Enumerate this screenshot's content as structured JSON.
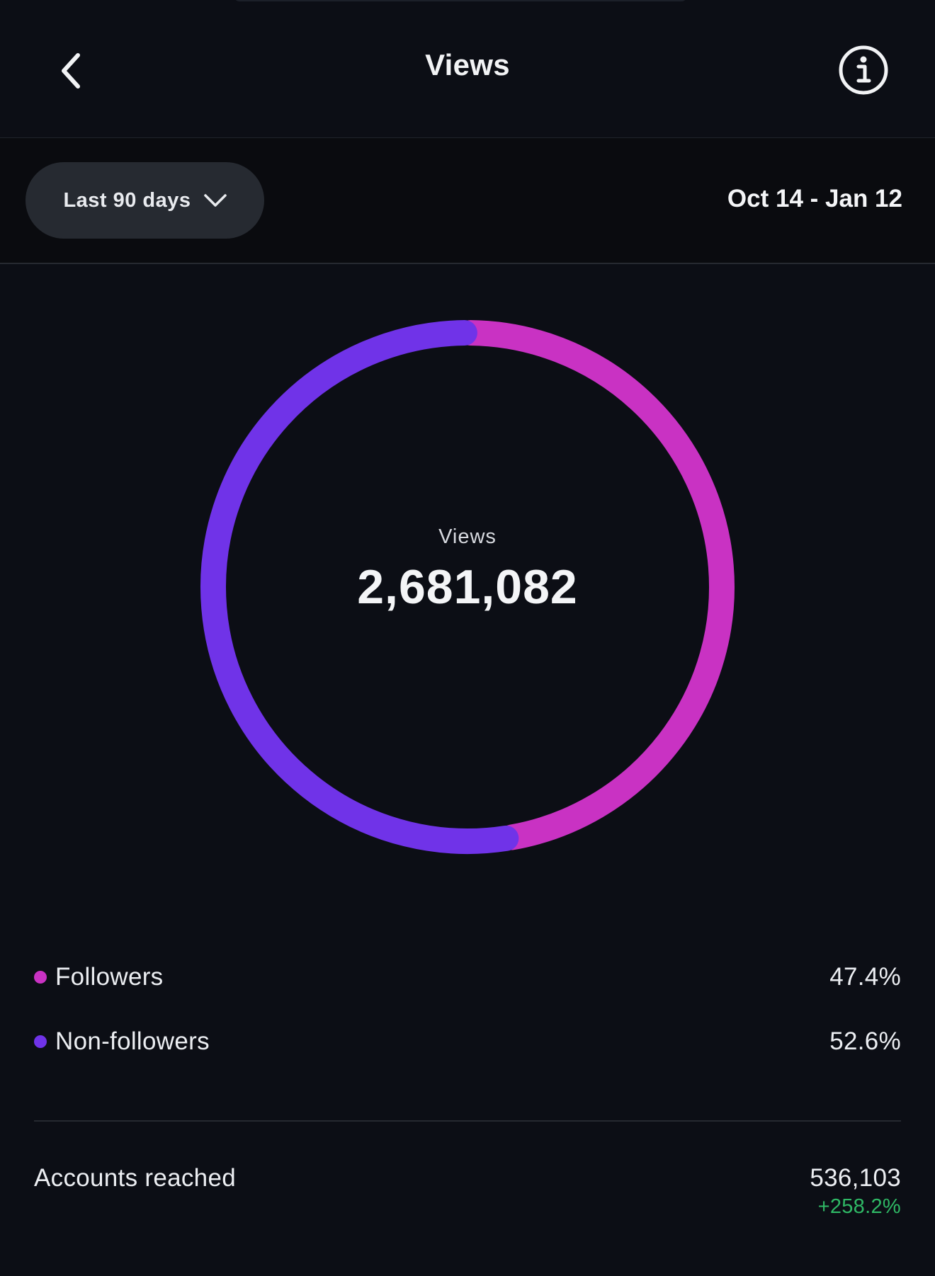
{
  "header": {
    "title": "Views",
    "back_icon": "chevron-left-icon",
    "info_icon": "info-icon"
  },
  "filter": {
    "range_label": "Last 90 days",
    "range_icon": "chevron-down-icon",
    "date_range": "Oct 14 - Jan 12"
  },
  "summary": {
    "label": "Views",
    "total": "2,681,082"
  },
  "chart_data": {
    "type": "pie",
    "variant": "donut",
    "slices": [
      {
        "name": "Followers",
        "value": 47.4,
        "color": "#c932c3"
      },
      {
        "name": "Non-followers",
        "value": 52.6,
        "color": "#7033e8"
      }
    ]
  },
  "legend": [
    {
      "name": "Followers",
      "value": "47.4%",
      "color": "#c932c3"
    },
    {
      "name": "Non-followers",
      "value": "52.6%",
      "color": "#7033e8"
    }
  ],
  "metrics": {
    "accounts_reached": {
      "label": "Accounts reached",
      "value": "536,103",
      "change": "+258.2%"
    }
  },
  "colors": {
    "background": "#0c0e15",
    "positive": "#2fb865"
  }
}
